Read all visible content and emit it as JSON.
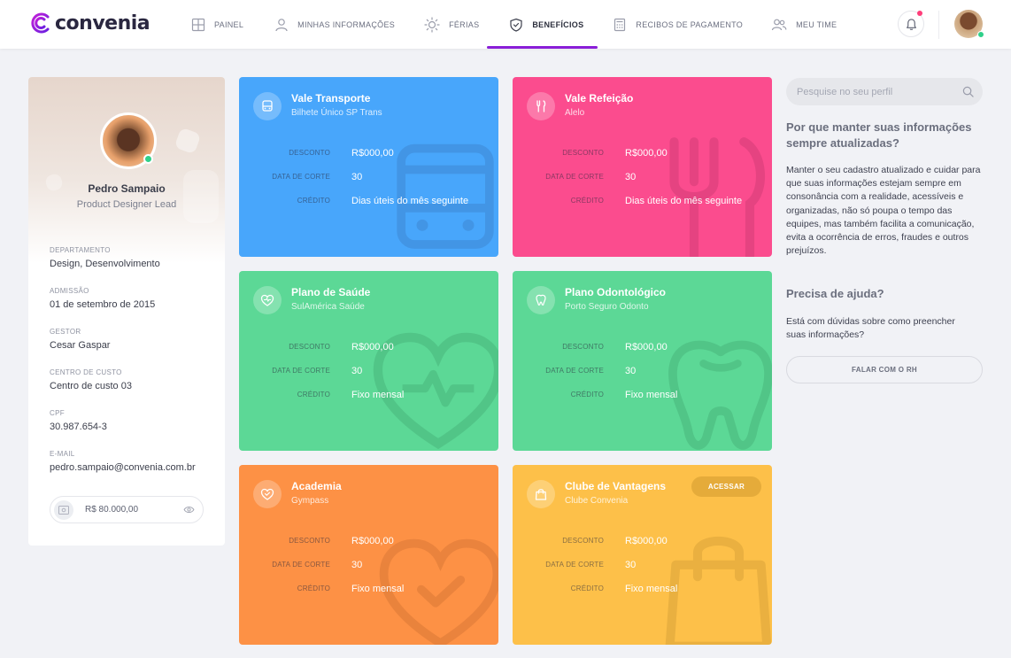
{
  "app": {
    "logo": "convenia"
  },
  "nav": {
    "items": [
      {
        "label": "Painel",
        "icon": "grid-icon",
        "active": false
      },
      {
        "label": "Minhas Informações",
        "icon": "user-icon",
        "active": false
      },
      {
        "label": "Férias",
        "icon": "sun-icon",
        "active": false
      },
      {
        "label": "Benefícios",
        "icon": "heart-shield-icon",
        "active": true
      },
      {
        "label": "Recibos de Pagamento",
        "icon": "calculator-icon",
        "active": false
      },
      {
        "label": "Meu Time",
        "icon": "users-icon",
        "active": false
      }
    ],
    "accent": "#8a1ed8"
  },
  "profile": {
    "name": "Pedro Sampaio",
    "role": "Product Designer Lead",
    "fields": [
      {
        "label": "Departamento",
        "value": "Design, Desenvolvimento"
      },
      {
        "label": "Admissão",
        "value": "01 de setembro de 2015"
      },
      {
        "label": "Gestor",
        "value": "Cesar Gaspar"
      },
      {
        "label": "Centro de custo",
        "value": "Centro de custo 03"
      },
      {
        "label": "CPF",
        "value": "30.987.654-3"
      },
      {
        "label": "E-mail",
        "value": "pedro.sampaio@convenia.com.br"
      }
    ],
    "salary": "R$ 80.000,00"
  },
  "labels": {
    "desconto": "Desconto",
    "corte": "Data de corte",
    "credito": "Crédito"
  },
  "benefits": [
    {
      "title": "Vale Transporte",
      "provider": "Bilhete Único SP Trans",
      "desconto": "R$000,00",
      "corte": "30",
      "credito": "Dias úteis do mês seguinte",
      "color": "#48a6fb",
      "icon": "bus-icon"
    },
    {
      "title": "Vale Refeição",
      "provider": "Alelo",
      "desconto": "R$000,00",
      "corte": "30",
      "credito": "Dias úteis do mês seguinte",
      "color": "#fb4c8e",
      "icon": "cutlery-icon"
    },
    {
      "title": "Plano de Saúde",
      "provider": "SulAmérica Saúde",
      "desconto": "R$000,00",
      "corte": "30",
      "credito": "Fixo mensal",
      "color": "#5cd896",
      "icon": "heart-pulse-icon"
    },
    {
      "title": "Plano Odontológico",
      "provider": "Porto Seguro Odonto",
      "desconto": "R$000,00",
      "corte": "30",
      "credito": "Fixo mensal",
      "color": "#5cd896",
      "icon": "tooth-icon"
    },
    {
      "title": "Academia",
      "provider": "Gympass",
      "desconto": "R$000,00",
      "corte": "30",
      "credito": "Fixo mensal",
      "color": "#fd9145",
      "icon": "heart-check-icon"
    },
    {
      "title": "Clube de Vantagens",
      "provider": "Clube Convenia",
      "desconto": "R$000,00",
      "corte": "30",
      "credito": "Fixo mensal",
      "color": "#fdc049",
      "icon": "shopping-bag-icon",
      "button": "Acessar"
    }
  ],
  "sidebar": {
    "search_placeholder": "Pesquise no seu perfil",
    "why_title": "Por que manter suas informações sempre atualizadas?",
    "why_text": "Manter o seu cadastro atualizado e cuidar para que suas informações estejam sempre em consonância com a realidade, acessíveis e organizadas, não só poupa o tempo das equipes, mas também facilita a comunicação, evita a ocorrência de erros, fraudes e outros prejuízos.",
    "help_title": "Precisa de ajuda?",
    "help_text": "Está com dúvidas sobre  como preencher suas informações?",
    "help_button": "Falar com o RH"
  }
}
